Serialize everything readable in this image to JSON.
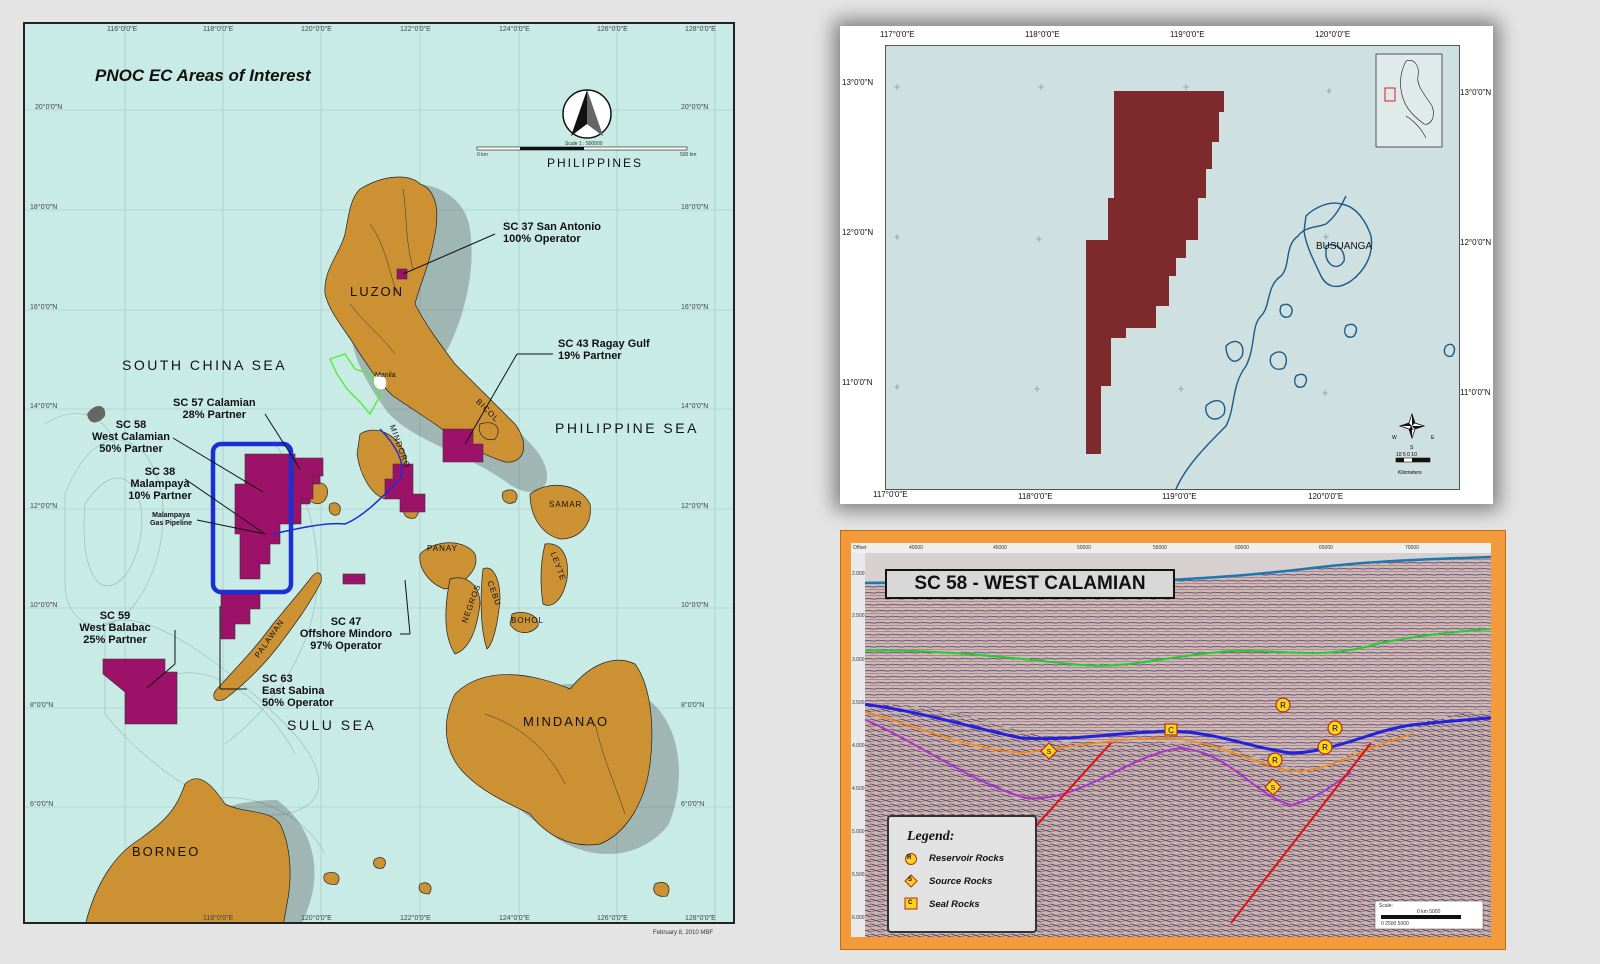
{
  "left_map": {
    "title": "PNOC EC Areas of Interest",
    "country": "PHILIPPINES",
    "scale_label": "Scale 1 : 500000",
    "scale_left": "0 km",
    "scale_right": "500 km",
    "top_ticks": [
      "116°0'0\"E",
      "118°0'0\"E",
      "120°0'0\"E",
      "122°0'0\"E",
      "124°0'0\"E",
      "126°0'0\"E",
      "128°0'0\"E"
    ],
    "bottom_ticks": [
      "118°0'0\"E",
      "120°0'0\"E",
      "122°0'0\"E",
      "124°0'0\"E",
      "126°0'0\"E",
      "128°0'0\"E"
    ],
    "left_ticks": [
      "20°0'0\"N",
      "18°0'0\"N",
      "16°0'0\"N",
      "14°0'0\"N",
      "12°0'0\"N",
      "10°0'0\"N",
      "8°0'0\"N",
      "6°0'0\"N"
    ],
    "right_ticks": [
      "20°0'0\"N",
      "18°0'0\"N",
      "16°0'0\"N",
      "14°0'0\"N",
      "12°0'0\"N",
      "10°0'0\"N",
      "8°0'0\"N",
      "6°0'0\"N"
    ],
    "seas": {
      "south_china": "SOUTH CHINA SEA",
      "philippine": "PHILIPPINE SEA",
      "sulu": "SULU SEA"
    },
    "lands": {
      "luzon": "LUZON",
      "mindanao": "MINDANAO",
      "borneo": "BORNEO",
      "mindoro": "MINDORO",
      "panay": "PANAY",
      "negros": "NEGROS",
      "cebu": "CEBU",
      "bohol": "BOHOL",
      "samar": "SAMAR",
      "leyte": "LEYTE",
      "bicol": "BICOL",
      "palawan": "PALAWAN",
      "manila": "Manila"
    },
    "contracts": {
      "sc37_name": "SC 37 San Antonio",
      "sc37_share": "100%  Operator",
      "sc43_name": "SC 43 Ragay Gulf",
      "sc43_share": "19%  Partner",
      "sc57_name": "SC 57 Calamian",
      "sc57_share": "28% Partner",
      "sc58_name": "SC 58",
      "sc58_sub": "West Calamian",
      "sc58_share": "50% Partner",
      "sc38_name": "SC 38",
      "sc38_sub": "Malampaya",
      "sc38_share": "10% Partner",
      "pipeline_1": "Malampaya",
      "pipeline_2": "Gas Pipeline",
      "sc59_name": "SC 59",
      "sc59_sub": "West Balabac",
      "sc59_share": "25% Partner",
      "sc63_name": "SC 63",
      "sc63_sub": "East Sabina",
      "sc63_share": "50% Operator",
      "sc47_name": "SC 47",
      "sc47_sub": "Offshore Mindoro",
      "sc47_share": "97% Operator"
    },
    "date": "February 8, 2010    MBF",
    "colors": {
      "sea": "#c8ebe6",
      "land": "#cc9133",
      "block": "#9c1268",
      "highlight": "#1a2fd6"
    }
  },
  "block_map": {
    "top_ticks": [
      "117°0'0\"E",
      "118°0'0\"E",
      "119°0'0\"E",
      "120°0'0\"E"
    ],
    "bottom_ticks": [
      "117°0'0\"E",
      "118°0'0\"E",
      "119°0'0\"E",
      "120°0'0\"E"
    ],
    "left_ticks": [
      "13°0'0\"N",
      "12°0'0\"N",
      "11°0'0\"N"
    ],
    "right_ticks": [
      "13°0'0\"N",
      "12°0'0\"N",
      "11°0'0\"N"
    ],
    "island_label": "BUSUANGA",
    "scale_nums": "10 5  0     10",
    "scale_unit": "Kilometers",
    "compass": {
      "n": "N",
      "s": "S",
      "e": "E",
      "w": "W"
    },
    "colors": {
      "block": "#7e2a2c",
      "sea": "#cfe0e0",
      "coast": "#1a5a8a"
    }
  },
  "seismic": {
    "title": "SC 58 -  WEST CALAMIAN",
    "top_ticks": [
      "Offset",
      "40000",
      "45000",
      "50000",
      "55000",
      "60000",
      "65000",
      "70000"
    ],
    "left_ticks": [
      "2.000",
      "2.500",
      "3.000",
      "3.500",
      "4.000",
      "4.500",
      "5.000",
      "5.500",
      "6.000"
    ],
    "legend": {
      "title": "Legend:",
      "r_symbol": "R",
      "r_label": "Reservoir Rocks",
      "s_symbol": "S",
      "s_label": "Source Rocks",
      "c_symbol": "C",
      "c_label": "Seal Rocks"
    },
    "scale_title": "Scale:",
    "scale_km": "0 km   5000",
    "scale_nums": "0          2500          5000",
    "colors": {
      "frame": "#f39b3a",
      "horizon_green": "#22cc33",
      "horizon_blue": "#2222dd",
      "horizon_orange": "#ff8800",
      "horizon_purple": "#aa33cc",
      "fault": "#e01010"
    }
  }
}
